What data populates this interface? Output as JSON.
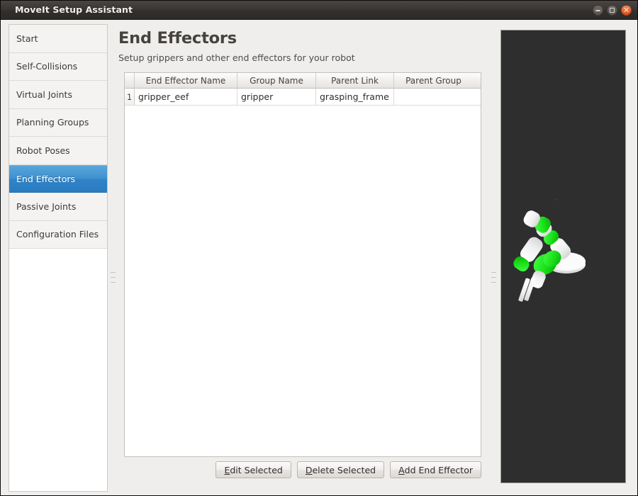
{
  "window": {
    "title": "MoveIt Setup Assistant",
    "controls": [
      {
        "name": "minimize",
        "glyph": "–"
      },
      {
        "name": "maximize",
        "glyph": "□"
      },
      {
        "name": "close",
        "glyph": "✕"
      }
    ],
    "close_color": "#dc4c18"
  },
  "sidebar": {
    "items": [
      {
        "label": "Start",
        "selected": false
      },
      {
        "label": "Self-Collisions",
        "selected": false
      },
      {
        "label": "Virtual Joints",
        "selected": false
      },
      {
        "label": "Planning Groups",
        "selected": false
      },
      {
        "label": "Robot Poses",
        "selected": false
      },
      {
        "label": "End Effectors",
        "selected": true
      },
      {
        "label": "Passive Joints",
        "selected": false
      },
      {
        "label": "Configuration Files",
        "selected": false
      }
    ],
    "selected_color": "#2f83c6"
  },
  "page": {
    "title": "End Effectors",
    "subtitle": "Setup grippers and other end effectors for your robot"
  },
  "table": {
    "headers": [
      "",
      "End Effector Name",
      "Group Name",
      "Parent Link",
      "Parent Group"
    ],
    "rows": [
      {
        "num": "1",
        "end_effector_name": "gripper_eef",
        "group_name": "gripper",
        "parent_link": "grasping_frame",
        "parent_group": ""
      }
    ]
  },
  "buttons": {
    "edit_selected": {
      "mnemonic": "E",
      "rest": "dit Selected"
    },
    "delete_selected": {
      "mnemonic": "D",
      "rest": "elete Selected"
    },
    "add_end_effector": {
      "mnemonic": "A",
      "rest": "dd End Effector"
    }
  },
  "viewport": {
    "background_color": "#2e2e2e",
    "robot_link_color": "#f2f2f2",
    "robot_joint_color": "#19e019",
    "description": "3D robot arm preview"
  }
}
